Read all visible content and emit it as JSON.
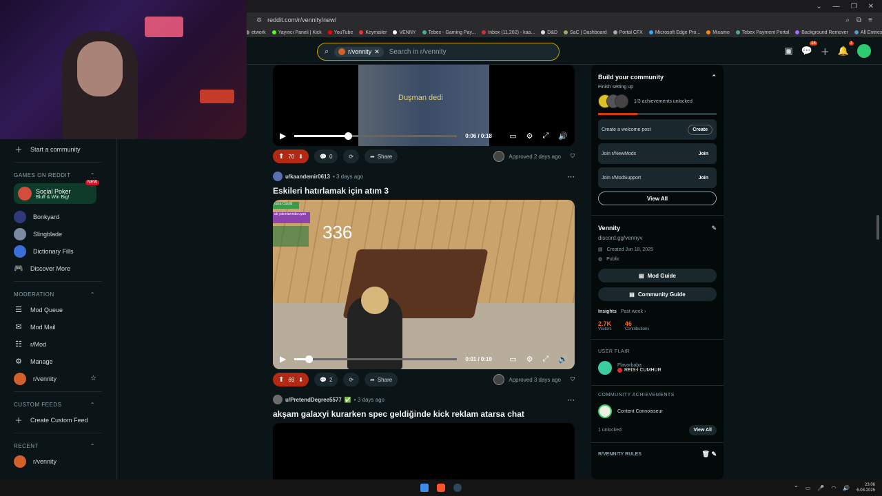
{
  "browser": {
    "url": "reddit.com/r/vennity/new/",
    "bookmarks": [
      "etwork",
      "Yayıncı Paneli | Kick",
      "YouTube",
      "Keymailer",
      "VENNY",
      "Tebex - Gaming Pay...",
      "Inbox (11,202) - kaa...",
      "D&D",
      "SaC | Dashboard",
      "Portal CFX",
      "Microsoft Edge Pro...",
      "Mixamo",
      "Tebex Payment Portal",
      "Background Remover",
      "All Entries - Entries |..."
    ]
  },
  "header": {
    "subreddit_chip": "r/vennity",
    "search_placeholder": "Search in r/vennity",
    "chat_badge": "14",
    "notif_badge": "1"
  },
  "sidebar": {
    "start_community": "Start a community",
    "games_section": "GAMES ON REDDIT",
    "promo": {
      "title": "Social Poker",
      "subtitle": "Bluff & Win Big!",
      "badge": "NEW"
    },
    "games": [
      "Bonkyard",
      "Slingblade",
      "Dictionary Fills",
      "Discover More"
    ],
    "moderation_section": "MODERATION",
    "moderation": [
      "Mod Queue",
      "Mod Mail",
      "r/Mod",
      "Manage",
      "r/vennity"
    ],
    "custom_feeds_section": "CUSTOM FEEDS",
    "create_feed": "Create Custom Feed",
    "recent_section": "RECENT",
    "recent": [
      "r/vennity"
    ]
  },
  "posts": [
    {
      "caption": "Duşman dedi",
      "time": "0:06 / 0:18",
      "progress": 0.33,
      "votes": "70",
      "comments": "0",
      "share": "Share",
      "approved": "Approved 2 days ago"
    },
    {
      "user": "u/kaandemir0613",
      "age": "• 3 days ago",
      "title": "Eskileri hatırlamak için atım 3",
      "counter": "336",
      "hud_green": "ozza Cüzdü",
      "hud_purple": "ak yakınlarında uyan",
      "time": "0:01 / 0:19",
      "progress": 0.09,
      "votes": "69",
      "comments": "2",
      "share": "Share",
      "approved": "Approved 3 days ago"
    },
    {
      "user": "u/PretendDegree5577",
      "age": "• 3 days ago",
      "title": "akşam galaxyi kurarken spec geldiğinde kick reklam atarsa chat"
    }
  ],
  "right": {
    "build_title": "Build your community",
    "build_sub": "Finish setting up",
    "achievements_text": "1/3 achievements unlocked",
    "progress": 0.33,
    "tasks": [
      {
        "label": "Create a welcome post",
        "action": "Create"
      },
      {
        "label": "Join r/NewMods",
        "action": "Join"
      },
      {
        "label": "Join r/ModSupport",
        "action": "Join"
      }
    ],
    "view_all": "View All",
    "community_name": "Vennity",
    "community_link": "discord.gg/vennyv",
    "created": "Created Jun 18, 2025",
    "visibility": "Public",
    "mod_guide": "Mod Guide",
    "community_guide": "Community Guide",
    "insights_label": "Insights",
    "insights_period": "Past week ›",
    "visitors_num": "2.7K",
    "visitors_label": "Visitors",
    "contrib_num": "46",
    "contrib_label": "Contributions",
    "user_flair_title": "USER FLAIR",
    "flair_user": "Flavorbaba",
    "flair_tag": "REIS-İ CUMHUR",
    "comm_ach_title": "COMMUNITY ACHIEVEMENTS",
    "comm_ach_name": "Content Connoisseur",
    "unlocked": "1 unlocked",
    "view_all_2": "View All",
    "rules_title": "R/VENNITY RULES"
  },
  "taskbar": {
    "time": "23:06",
    "date": "6.08.2025"
  }
}
